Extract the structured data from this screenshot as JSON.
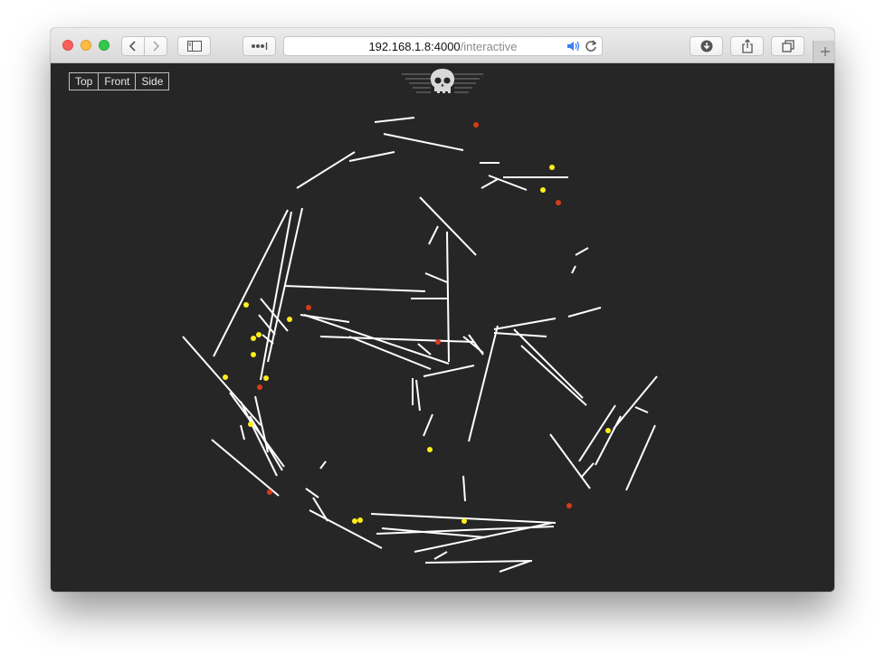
{
  "browser": {
    "url_host": "192.168.1.8:4000",
    "url_path": "/interactive",
    "icons": {
      "back": "chevron-left-icon",
      "forward": "chevron-right-icon",
      "sidebar": "sidebar-icon",
      "more": "ellipsis-icon",
      "audio": "speaker-icon",
      "reload": "reload-icon",
      "download": "download-icon",
      "share": "share-icon",
      "tabs": "tabs-icon",
      "new_tab": "plus-icon"
    }
  },
  "toolbar": {
    "view_buttons": [
      "Top",
      "Front",
      "Side"
    ]
  },
  "logo": {
    "icon": "skull-icon"
  },
  "colors": {
    "background": "#262626",
    "segment": "#ffffff",
    "node_yellow": "#ffee1a",
    "node_red": "#d83a1a"
  }
}
